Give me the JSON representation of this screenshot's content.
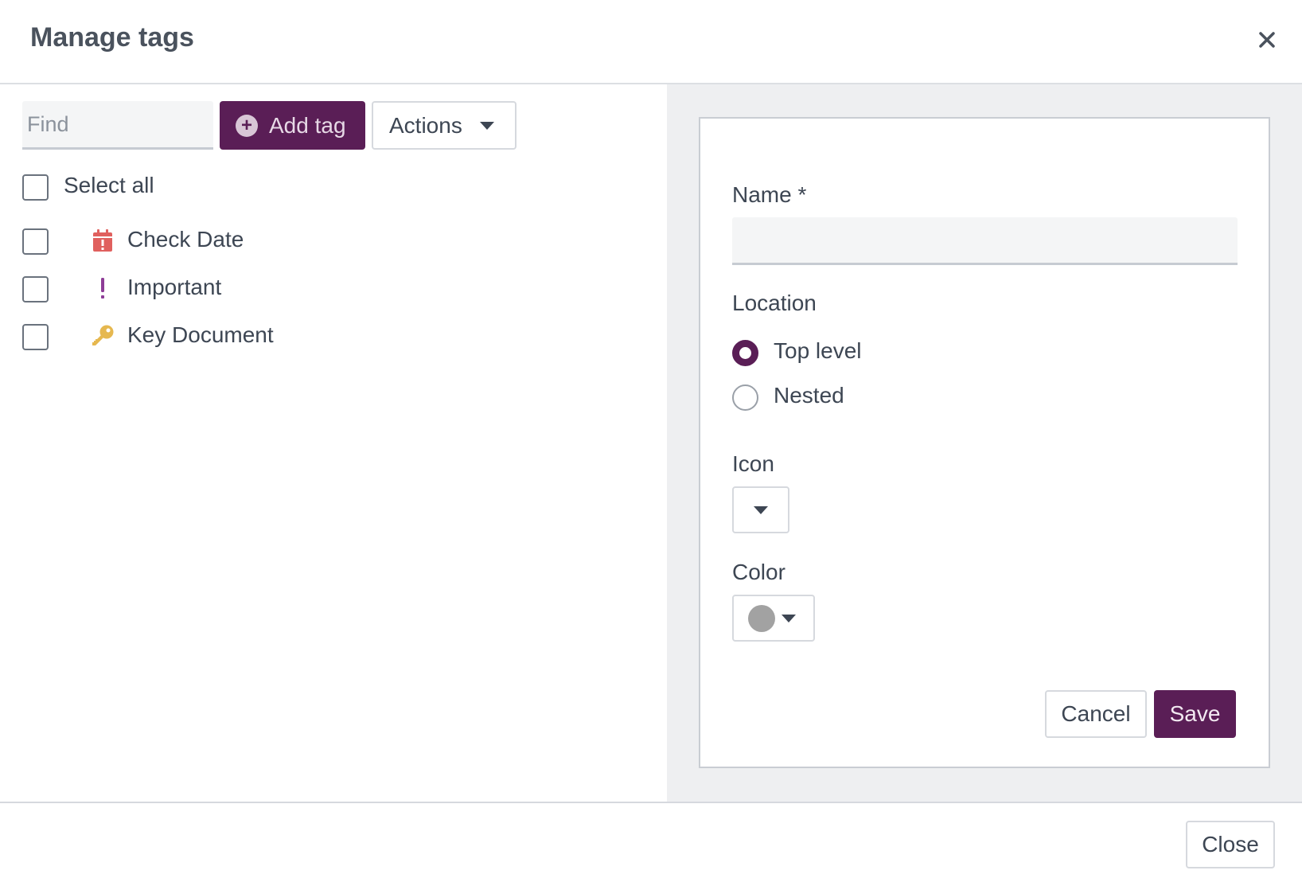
{
  "dialog": {
    "title": "Manage tags",
    "close_icon": "close-icon"
  },
  "toolbar": {
    "find_placeholder": "Find",
    "find_value": "",
    "add_tag_label": "Add tag",
    "add_tag_icon": "plus-circle-icon",
    "actions_label": "Actions"
  },
  "tag_list": {
    "select_all_label": "Select all",
    "select_all_checked": false,
    "tags": [
      {
        "label": "Check Date",
        "icon": "calendar-exclamation-icon",
        "color": "#e0605e",
        "checked": false
      },
      {
        "label": "Important",
        "icon": "exclamation-icon",
        "color": "#8e3d97",
        "checked": false
      },
      {
        "label": "Key Document",
        "icon": "key-icon",
        "color": "#e6b84f",
        "checked": false
      }
    ]
  },
  "form": {
    "name_label": "Name *",
    "name_value": "",
    "location_label": "Location",
    "location_options": [
      {
        "label": "Top level",
        "selected": true
      },
      {
        "label": "Nested",
        "selected": false
      }
    ],
    "icon_label": "Icon",
    "icon_value": "",
    "color_label": "Color",
    "color_value": "#a2a2a2",
    "cancel_label": "Cancel",
    "save_label": "Save"
  },
  "footer": {
    "close_label": "Close"
  },
  "colors": {
    "accent": "#5a1e56",
    "panel_bg": "#eeeff1",
    "text": "#3d4653"
  }
}
